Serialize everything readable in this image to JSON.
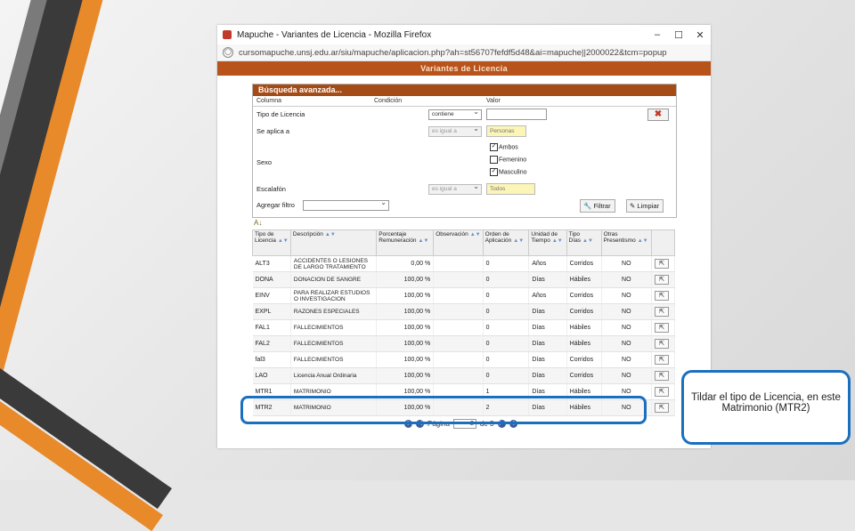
{
  "window": {
    "title": "Mapuche - Variantes de Licencia - Mozilla Firefox",
    "url": "cursomapuche.unsj.edu.ar/siu/mapuche/aplicacion.php?ah=st56707fefdf5d48&ai=mapuche||2000022&tcm=popup",
    "page_header": "Variantes de Licencia",
    "controls": {
      "minimize": "–",
      "maximize": "☐",
      "close": "✕"
    }
  },
  "search": {
    "title": "Búsqueda avanzada...",
    "headers": {
      "column": "Columna",
      "condition": "Condición",
      "value": "Valor"
    },
    "rows": {
      "tipo_licencia": {
        "label": "Tipo de Licencia",
        "condition": "contiene"
      },
      "se_aplica_a": {
        "label": "Se aplica a",
        "condition": "es igual a",
        "value": "Personas"
      },
      "sexo": {
        "label": "Sexo",
        "options": [
          "Ambos",
          "Femenino",
          "Masculino"
        ],
        "checked": [
          true,
          false,
          true
        ]
      },
      "escalafon": {
        "label": "Escalafón",
        "condition": "es igual a",
        "value": "Todos"
      }
    },
    "add_filter_label": "Agregar filtro",
    "filter_button": "Filtrar",
    "clear_button": "Limpiar"
  },
  "grid": {
    "columns": [
      "Tipo de Licencia",
      "Descripción",
      "Porcentaje Remuneración",
      "Observación",
      "Orden de Aplicación",
      "Unidad de Tiempo",
      "Tipo Días",
      "Otras Presentismo"
    ],
    "rows": [
      [
        "ALT3",
        "ACCIDENTES O LESIONES DE LARGO TRATAMIENTO",
        "0,00 %",
        "",
        "0",
        "Años",
        "Corridos",
        "NO"
      ],
      [
        "DONA",
        "DONACION DE SANGRE",
        "100,00 %",
        "",
        "0",
        "Días",
        "Hábiles",
        "NO"
      ],
      [
        "EINV",
        "PARA REALIZAR ESTUDIOS O INVESTIGACION",
        "100,00 %",
        "",
        "0",
        "Años",
        "Corridos",
        "NO"
      ],
      [
        "EXPL",
        "RAZONES ESPECIALES",
        "100,00 %",
        "",
        "0",
        "Días",
        "Corridos",
        "NO"
      ],
      [
        "FAL1",
        "FALLECIMIENTOS",
        "100,00 %",
        "",
        "0",
        "Días",
        "Hábiles",
        "NO"
      ],
      [
        "FAL2",
        "FALLECIMIENTOS",
        "100,00 %",
        "",
        "0",
        "Días",
        "Hábiles",
        "NO"
      ],
      [
        "fal3",
        "FALLECIMIENTOS",
        "100,00 %",
        "",
        "0",
        "Días",
        "Corridos",
        "NO"
      ],
      [
        "LAO",
        "Licencia Anual Ordinaria",
        "100,00 %",
        "",
        "0",
        "Días",
        "Corridos",
        "NO"
      ],
      [
        "MTR1",
        "MATRIMONIO",
        "100,00 %",
        "",
        "1",
        "Días",
        "Hábiles",
        "NO"
      ],
      [
        "MTR2",
        "MATRIMONIO",
        "100,00 %",
        "",
        "2",
        "Días",
        "Hábiles",
        "NO"
      ]
    ],
    "edit_icon": "⇱"
  },
  "pager": {
    "label": "Página",
    "current": "2",
    "of_label": "de 3"
  },
  "callout": {
    "text": "Tildar el tipo de Licencia, en este Matrimonio (MTR2)"
  },
  "colors": {
    "header": "#b8531b",
    "panel_title": "#a54b16",
    "highlight": "#1a6fbf",
    "accent_orange": "#e8892a"
  }
}
